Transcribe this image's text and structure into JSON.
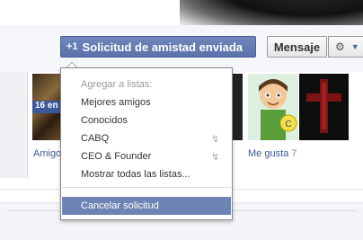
{
  "header": {
    "friend_request_button": "Solicitud de amistad enviada",
    "friend_request_icon": "user-plus-icon",
    "message_button": "Mensaje",
    "settings_icon": "gear-icon",
    "settings_caret_icon": "chevron-down-icon"
  },
  "thumbs": {
    "badge_text": "16 en",
    "caption_left": "Amigo",
    "caption_right_link": "Me gusta",
    "caption_right_count": "7"
  },
  "menu": {
    "heading": "Agregar a listas:",
    "items": [
      {
        "label": "Mejores amigos",
        "bolt": false
      },
      {
        "label": "Conocidos",
        "bolt": false
      },
      {
        "label": "CABQ",
        "bolt": true
      },
      {
        "label": "CEO & Founder",
        "bolt": true
      },
      {
        "label": "Mostrar todas las listas...",
        "bolt": false
      }
    ],
    "bolt_icon": "lightning-icon",
    "cancel": "Cancelar solicitud"
  }
}
